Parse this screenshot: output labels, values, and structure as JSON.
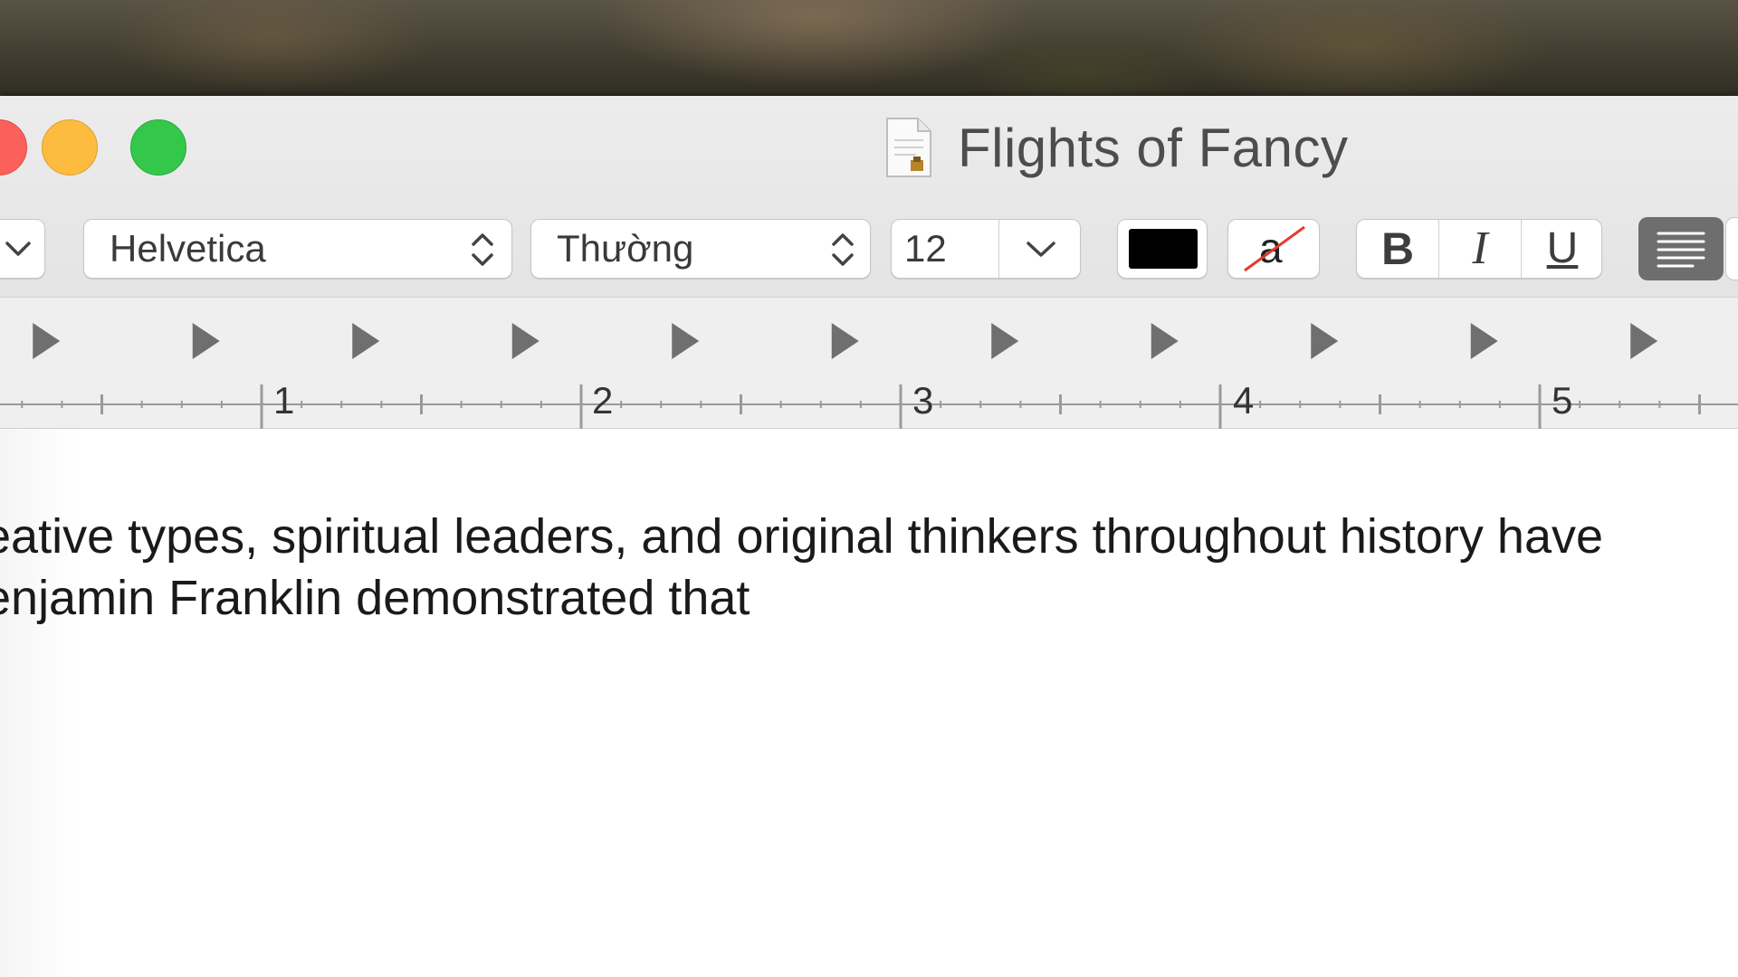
{
  "window": {
    "title": "Flights of Fancy",
    "document_icon": "document-icon"
  },
  "toolbar": {
    "font_family": "Helvetica",
    "typeface": "Thường",
    "font_size": "12",
    "text_color": "#000000",
    "bold_label": "B",
    "italic_label": "I",
    "underline_label": "U",
    "highlight_label": "a"
  },
  "ruler": {
    "numbers": [
      "1",
      "2",
      "3",
      "4",
      "5"
    ]
  },
  "document": {
    "lines": [
      "eative types, spiritual leaders, and original thinkers throughout history have",
      "enjamin Franklin demonstrated that"
    ]
  },
  "colors": {
    "close": "#fc605b",
    "minimize": "#fdbc40",
    "zoom": "#34c84a"
  }
}
